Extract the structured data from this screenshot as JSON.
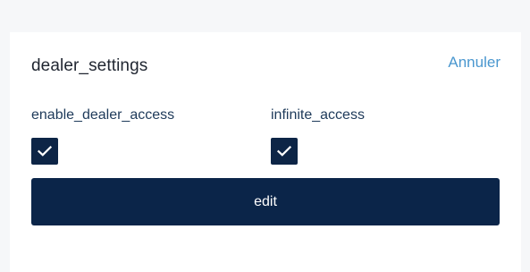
{
  "card": {
    "title": "dealer_settings",
    "cancel_label": "Annuler"
  },
  "fields": [
    {
      "label": "enable_dealer_access",
      "checked": true
    },
    {
      "label": "infinite_access",
      "checked": true
    }
  ],
  "actions": {
    "edit_label": "edit"
  },
  "icons": {
    "checkbox": "check-icon"
  },
  "colors": {
    "primary": "#0b2549",
    "link": "#4a97cf",
    "label": "#1e3a5a"
  }
}
